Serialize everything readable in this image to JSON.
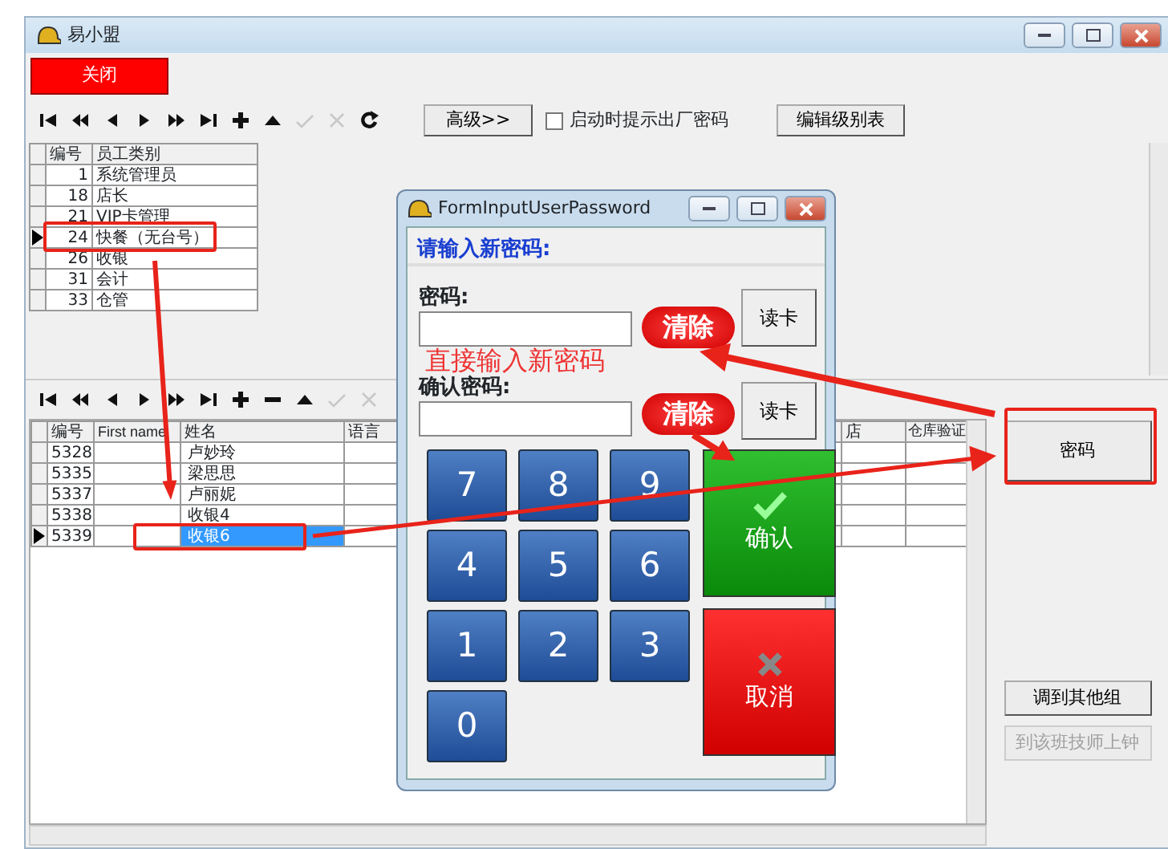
{
  "window": {
    "title": "易小盟"
  },
  "close_button": "关闭",
  "toolbar": {
    "buttons": [
      {
        "kind": "first",
        "disabled": false
      },
      {
        "kind": "prev_page",
        "disabled": false
      },
      {
        "kind": "prev",
        "disabled": false
      },
      {
        "kind": "next",
        "disabled": false
      },
      {
        "kind": "next_page",
        "disabled": false
      },
      {
        "kind": "last",
        "disabled": false
      },
      {
        "kind": "insert",
        "disabled": false
      },
      {
        "kind": "post",
        "disabled": false
      },
      {
        "kind": "check",
        "disabled": true
      },
      {
        "kind": "cancel",
        "disabled": true
      },
      {
        "kind": "refresh",
        "disabled": false
      }
    ],
    "advanced_button": "高级>>",
    "checkbox": {
      "label": "启动时提示出厂密码",
      "checked": false
    },
    "edit_button": "编辑级别表"
  },
  "category_table": {
    "columns": [
      "编号",
      "员工类别"
    ],
    "rows": [
      {
        "id": "1",
        "name": "系统管理员",
        "selected": false
      },
      {
        "id": "18",
        "name": "店长",
        "selected": false
      },
      {
        "id": "21",
        "name": "VIP卡管理",
        "selected": false
      },
      {
        "id": "24",
        "name": "快餐（无台号）",
        "selected": true
      },
      {
        "id": "26",
        "name": "收银",
        "selected": false
      },
      {
        "id": "31",
        "name": "会计",
        "selected": false
      },
      {
        "id": "33",
        "name": "仓管",
        "selected": false
      }
    ]
  },
  "employee_toolbar": {
    "buttons": [
      {
        "kind": "first",
        "disabled": false
      },
      {
        "kind": "prev_page",
        "disabled": false
      },
      {
        "kind": "prev",
        "disabled": false
      },
      {
        "kind": "next",
        "disabled": false
      },
      {
        "kind": "next_page",
        "disabled": false
      },
      {
        "kind": "last",
        "disabled": false
      },
      {
        "kind": "insert",
        "disabled": false
      },
      {
        "kind": "delete",
        "disabled": false
      },
      {
        "kind": "post",
        "disabled": false
      },
      {
        "kind": "check",
        "disabled": true
      },
      {
        "kind": "cancel",
        "disabled": true
      }
    ]
  },
  "employee_table": {
    "columns": [
      "编号",
      "First name",
      "姓名",
      "语言",
      "店",
      "仓库验证"
    ],
    "rows": [
      {
        "id": "5328",
        "name": "卢妙玲",
        "selected": false
      },
      {
        "id": "5335",
        "name": "梁思思",
        "selected": false
      },
      {
        "id": "5337",
        "name": "卢丽妮",
        "selected": false
      },
      {
        "id": "5338",
        "name": "收银4",
        "selected": false
      },
      {
        "id": "5339",
        "name": "收银6",
        "selected": true
      }
    ]
  },
  "side_buttons": [
    {
      "label": "密码",
      "disabled": false
    },
    {
      "label": "调到其他组",
      "disabled": false
    },
    {
      "label": "到该班技师上钟",
      "disabled": true
    }
  ],
  "dialog": {
    "title": "FormInputUserPassword",
    "prompt": "请输入新密码:",
    "fields": [
      {
        "label": "密码:",
        "button": "读卡"
      },
      {
        "label": "确认密码:",
        "button": "读卡"
      }
    ],
    "keypad": [
      "7",
      "8",
      "9",
      "4",
      "5",
      "6",
      "1",
      "2",
      "3",
      "0"
    ],
    "confirm": "确认",
    "cancel": "取消"
  },
  "annotations": {
    "labels": [
      "清除",
      "清除"
    ],
    "note": "直接输入新密码"
  }
}
